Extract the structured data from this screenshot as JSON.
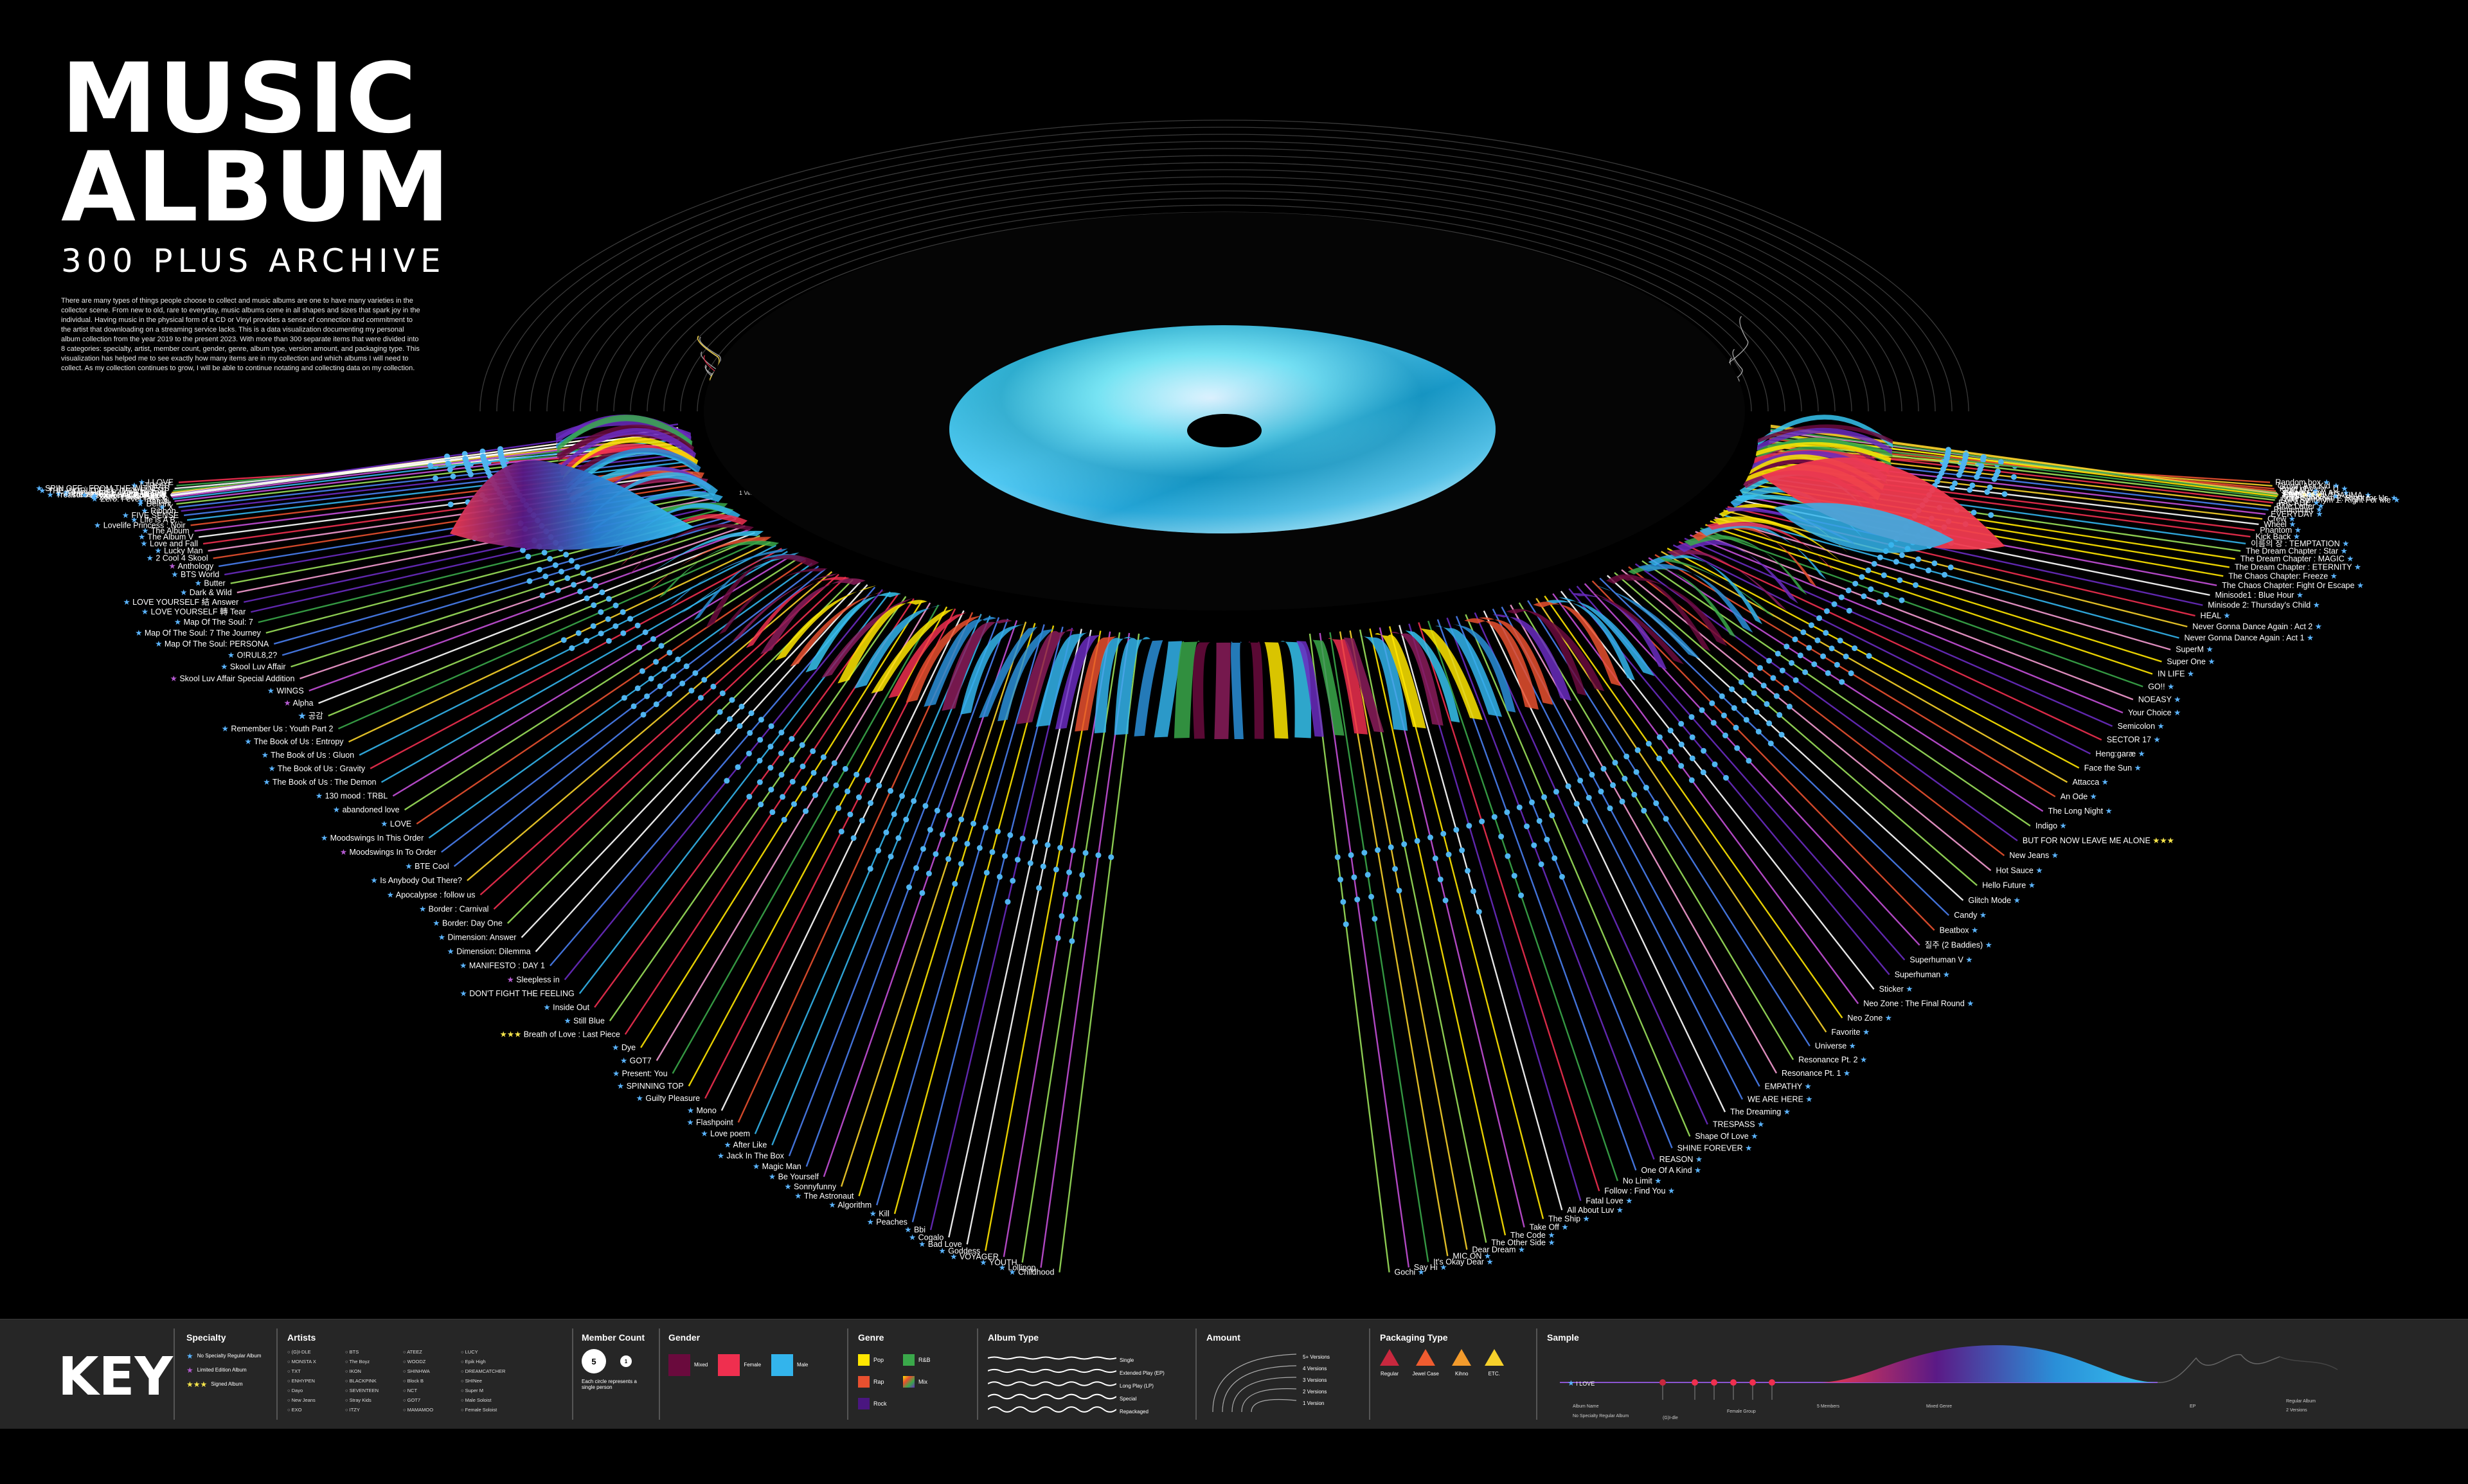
{
  "header": {
    "title_line1": "MUSIC",
    "title_line2": "ALBUM",
    "subtitle": "300 PLUS ARCHIVE",
    "description": "There are many types of things people choose to collect and music albums are one to have many varieties in the collector scene. From new to old, rare to everyday, music albums come in all shapes and sizes that spark joy in the individual. Having music in the physical form of a CD or Vinyl provides a sense of connection and commitment to the artist that downloading on a streaming service lacks. This is a data visualization documenting my personal album collection from the year 2019 to the present 2023. With more than 300 separate items that were divided into 8 categories: specialty, artist, member count, gender, genre, album type, version amount, and packaging type. This visualization has helped me to see exactly how many items are in my collection and which albums I will need to collect. As my collection continues to grow, I will be able to continue notating and collecting data on my collection."
  },
  "rings": {
    "labels": [
      "1 Version",
      "2 Versions",
      "3 Versions",
      "4 Versions",
      "5+ Versions"
    ]
  },
  "colors": {
    "mixed": "#6a0a3d",
    "female": "#ef2f4f",
    "male": "#33b4ec",
    "pop": "#ffe600",
    "rap": "#e8502f",
    "rock": "#4a1680",
    "rnb": "#3aa84a",
    "mix": "#6a2cc0",
    "regular": "#c8283e",
    "jewel": "#ef5c30",
    "kihno": "#f39b2c",
    "etc": "#f7d12b"
  },
  "albums_left": [
    {
      "name": "I LOVE",
      "star": "blue"
    },
    {
      "name": "I TRUST",
      "star": "blue"
    },
    {
      "name": "SPIN OFF : FROM THE WITNESS",
      "star": "blue"
    },
    {
      "name": "THE WORLD EP.1 : MOVEMENT",
      "star": "blue"
    },
    {
      "name": "Treasure EP.1 : All To Zero",
      "star": "blue"
    },
    {
      "name": "Treasure EP.2 : Zero To One",
      "star": "blue"
    },
    {
      "name": "Treasure EP.3 : One To All",
      "star": "blue"
    },
    {
      "name": "Treasure EP. Fin : All To Action",
      "star": "blue"
    },
    {
      "name": "Zero: Fever Epilogue",
      "star": "blue"
    },
    {
      "name": "Zero: Fever Part.1",
      "star": "blue"
    },
    {
      "name": "Zero: Fever Part. 2",
      "star": "blue"
    },
    {
      "name": "Zero: Fever Part. 3",
      "star": "blue"
    },
    {
      "name": "Bambi",
      "star": "blue"
    },
    {
      "name": "Delight",
      "star": "blue"
    },
    {
      "name": "X",
      "star": "blue"
    },
    {
      "name": "Ribbon",
      "star": "blue"
    },
    {
      "name": "FIVE SENSE",
      "star": "blue"
    },
    {
      "name": "Life is A B...",
      "star": "blue"
    },
    {
      "name": "Lovelife Princess : Noir",
      "star": "blue"
    },
    {
      "name": "The Album",
      "star": "blue"
    },
    {
      "name": "The Album V",
      "star": "blue"
    },
    {
      "name": "Love and Fall",
      "star": "blue"
    },
    {
      "name": "Lucky Man",
      "star": "blue"
    },
    {
      "name": "2 Cool 4 Skool",
      "star": "blue"
    },
    {
      "name": "Anthology",
      "star": "purple"
    },
    {
      "name": "BTS World",
      "star": "blue"
    },
    {
      "name": "Butter",
      "star": "blue"
    },
    {
      "name": "Dark & Wild",
      "star": "blue"
    },
    {
      "name": "LOVE YOURSELF 結 Answer",
      "star": "blue"
    },
    {
      "name": "LOVE YOURSELF 轉 Tear",
      "star": "blue"
    },
    {
      "name": "Map Of The Soul: 7",
      "star": "blue"
    },
    {
      "name": "Map Of The Soul: 7 The Journey",
      "star": "blue"
    },
    {
      "name": "Map Of The Soul: PERSONA",
      "star": "blue"
    },
    {
      "name": "O!RUL8,2?",
      "star": "blue"
    },
    {
      "name": "Skool Luv Affair",
      "star": "blue"
    },
    {
      "name": "Skool Luv Affair Special Addition",
      "star": "purple"
    },
    {
      "name": "WINGS",
      "star": "blue"
    },
    {
      "name": "Alpha",
      "star": "purple"
    },
    {
      "name": "공감",
      "star": "blue"
    },
    {
      "name": "Remember Us : Youth Part 2",
      "star": "blue"
    },
    {
      "name": "The Book of Us : Entropy",
      "star": "blue"
    },
    {
      "name": "The Book of Us : Gluon",
      "star": "blue"
    },
    {
      "name": "The Book of Us : Gravity",
      "star": "blue"
    },
    {
      "name": "The Book of Us : The Demon",
      "star": "blue"
    },
    {
      "name": "130 mood : TRBL",
      "star": "blue"
    },
    {
      "name": "abandoned love",
      "star": "blue"
    },
    {
      "name": "LOVE",
      "star": "blue"
    },
    {
      "name": "Moodswings In This Order",
      "star": "blue"
    },
    {
      "name": "Moodswings In To Order",
      "star": "purple"
    },
    {
      "name": "BTE Cool",
      "star": "blue"
    },
    {
      "name": "Is Anybody Out There?",
      "star": "blue"
    },
    {
      "name": "Apocalypse : follow us",
      "star": "blue"
    },
    {
      "name": "Border : Carnival",
      "star": "blue"
    },
    {
      "name": "Border: Day One",
      "star": "blue"
    },
    {
      "name": "Dimension: Answer",
      "star": "blue"
    },
    {
      "name": "Dimension: Dilemma",
      "star": "blue"
    },
    {
      "name": "MANIFESTO : DAY 1",
      "star": "blue"
    },
    {
      "name": "Sleepless in",
      "star": "purple"
    },
    {
      "name": "DON'T FIGHT THE FEELING",
      "star": "blue"
    },
    {
      "name": "Inside Out",
      "star": "blue"
    },
    {
      "name": "Still Blue",
      "star": "blue"
    },
    {
      "name": "Breath of Love : Last Piece",
      "star": "yellow"
    },
    {
      "name": "Dye",
      "star": "blue"
    },
    {
      "name": "GOT7",
      "star": "blue"
    },
    {
      "name": "Present: You",
      "star": "blue"
    },
    {
      "name": "SPINNING TOP",
      "star": "blue"
    },
    {
      "name": "Guilty Pleasure",
      "star": "blue"
    },
    {
      "name": "Mono",
      "star": "blue"
    },
    {
      "name": "Flashpoint",
      "star": "blue"
    },
    {
      "name": "Love poem",
      "star": "blue"
    },
    {
      "name": "After Like",
      "star": "blue"
    },
    {
      "name": "Jack In The Box",
      "star": "blue"
    },
    {
      "name": "Magic Man",
      "star": "blue"
    },
    {
      "name": "Be Yourself",
      "star": "blue"
    },
    {
      "name": "Sonnyfunny",
      "star": "blue"
    },
    {
      "name": "The Astronaut",
      "star": "blue"
    },
    {
      "name": "Algorithm",
      "star": "blue"
    },
    {
      "name": "Kill",
      "star": "blue"
    },
    {
      "name": "Peaches",
      "star": "blue"
    },
    {
      "name": "Bbi",
      "star": "blue"
    },
    {
      "name": "Cogalo",
      "star": "blue"
    },
    {
      "name": "Bad Love",
      "star": "blue"
    },
    {
      "name": "Goddess",
      "star": "blue"
    },
    {
      "name": "VOYAGER",
      "star": "blue"
    },
    {
      "name": "YOUTH",
      "star": "blue"
    },
    {
      "name": "Lollipop",
      "star": "blue"
    },
    {
      "name": "Childhood",
      "star": "blue"
    }
  ],
  "albums_right": [
    {
      "name": "Random box",
      "star": "blue"
    },
    {
      "name": "Grown Ass Kid",
      "star": "blue"
    },
    {
      "name": "Point of View : U",
      "star": "blue"
    },
    {
      "name": "SUGAR",
      "star": "blue"
    },
    {
      "name": "Colors From Ars",
      "star": "blue"
    },
    {
      "name": "Eternal",
      "star": "blue"
    },
    {
      "name": "SET",
      "star": "yellow"
    },
    {
      "name": "Equal",
      "star": "blue"
    },
    {
      "name": "COLORFUL TRAUMA",
      "star": "blue"
    },
    {
      "name": "OBSESSION",
      "star": "blue"
    },
    {
      "name": "Love Synonym 2: Right for Us",
      "star": "blue"
    },
    {
      "name": "Love Synonym 1: Right For Me",
      "star": "blue"
    },
    {
      "name": "FACADE",
      "star": "blue"
    },
    {
      "name": "Blue Letter",
      "star": "blue"
    },
    {
      "name": "Remember",
      "star": "blue"
    },
    {
      "name": "EVERYDAY",
      "star": "blue"
    },
    {
      "name": "Crew",
      "star": "blue"
    },
    {
      "name": "Wheel",
      "star": "blue"
    },
    {
      "name": "Phantom",
      "star": "blue"
    },
    {
      "name": "Kick Back",
      "star": "blue"
    },
    {
      "name": "이름의 장 : TEMPTATION",
      "star": "blue"
    },
    {
      "name": "The Dream Chapter : Star",
      "star": "blue"
    },
    {
      "name": "The Dream Chapter : MAGIC",
      "star": "blue"
    },
    {
      "name": "The Dream Chapter : ETERNITY",
      "star": "blue"
    },
    {
      "name": "The Chaos Chapter: Freeze",
      "star": "blue"
    },
    {
      "name": "The Chaos Chapter: Fight Or Escape",
      "star": "blue"
    },
    {
      "name": "Minisode1 : Blue Hour",
      "star": "blue"
    },
    {
      "name": "Minisode 2: Thursday's Child",
      "star": "blue"
    },
    {
      "name": "HEAL",
      "star": "blue"
    },
    {
      "name": "Never Gonna Dance Again : Act 2",
      "star": "blue"
    },
    {
      "name": "Never Gonna Dance Again : Act 1",
      "star": "blue"
    },
    {
      "name": "SuperM",
      "star": "blue"
    },
    {
      "name": "Super One",
      "star": "blue"
    },
    {
      "name": "IN LIFE",
      "star": "blue"
    },
    {
      "name": "GO!!",
      "star": "blue"
    },
    {
      "name": "NOEASY",
      "star": "blue"
    },
    {
      "name": "Your Choice",
      "star": "blue"
    },
    {
      "name": "Semicolon",
      "star": "blue"
    },
    {
      "name": "SECTOR 17",
      "star": "blue"
    },
    {
      "name": "Heng:garæ",
      "star": "blue"
    },
    {
      "name": "Face the Sun",
      "star": "blue"
    },
    {
      "name": "Attacca",
      "star": "blue"
    },
    {
      "name": "An Ode",
      "star": "blue"
    },
    {
      "name": "The Long Night",
      "star": "blue"
    },
    {
      "name": "Indigo",
      "star": "blue"
    },
    {
      "name": "BUT FOR NOW LEAVE ME ALONE",
      "star": "yellow"
    },
    {
      "name": "New Jeans",
      "star": "blue"
    },
    {
      "name": "Hot Sauce",
      "star": "blue"
    },
    {
      "name": "Hello Future",
      "star": "blue"
    },
    {
      "name": "Glitch Mode",
      "star": "blue"
    },
    {
      "name": "Candy",
      "star": "blue"
    },
    {
      "name": "Beatbox",
      "star": "blue"
    },
    {
      "name": "질주 (2 Baddies)",
      "star": "blue"
    },
    {
      "name": "Superhuman V",
      "star": "blue"
    },
    {
      "name": "Superhuman",
      "star": "blue"
    },
    {
      "name": "Sticker",
      "star": "blue"
    },
    {
      "name": "Neo Zone : The Final Round",
      "star": "blue"
    },
    {
      "name": "Neo Zone",
      "star": "blue"
    },
    {
      "name": "Favorite",
      "star": "blue"
    },
    {
      "name": "Universe",
      "star": "blue"
    },
    {
      "name": "Resonance Pt. 2",
      "star": "blue"
    },
    {
      "name": "Resonance Pt. 1",
      "star": "blue"
    },
    {
      "name": "EMPATHY",
      "star": "blue"
    },
    {
      "name": "WE ARE HERE",
      "star": "blue"
    },
    {
      "name": "The Dreaming",
      "star": "blue"
    },
    {
      "name": "TRESPASS",
      "star": "blue"
    },
    {
      "name": "Shape Of Love",
      "star": "blue"
    },
    {
      "name": "SHINE FOREVER",
      "star": "blue"
    },
    {
      "name": "REASON",
      "star": "blue"
    },
    {
      "name": "One Of A Kind",
      "star": "blue"
    },
    {
      "name": "No Limit",
      "star": "blue"
    },
    {
      "name": "Follow : Find You",
      "star": "blue"
    },
    {
      "name": "Fatal Love",
      "star": "blue"
    },
    {
      "name": "All About Luv",
      "star": "blue"
    },
    {
      "name": "The Ship",
      "star": "blue"
    },
    {
      "name": "Take Off",
      "star": "blue"
    },
    {
      "name": "The Code",
      "star": "blue"
    },
    {
      "name": "The Other Side",
      "star": "blue"
    },
    {
      "name": "Dear Dream",
      "star": "blue"
    },
    {
      "name": "MIC ON",
      "star": "blue"
    },
    {
      "name": "It's Okay Dear",
      "star": "blue"
    },
    {
      "name": "Say Hi",
      "star": "blue"
    },
    {
      "name": "Gochi",
      "star": "blue"
    }
  ],
  "key": {
    "title": "KEY",
    "specialty": {
      "heading": "Specialty",
      "items": [
        "No Specialty Regular Album",
        "Limited Edition Album",
        "Signed Album"
      ]
    },
    "artists": {
      "heading": "Artists",
      "items": [
        "(G)I-DLE",
        "MONSTA X",
        "TXT",
        "ENHYPEN",
        "Dayo",
        "New Jeans",
        "EXO",
        "BTS",
        "The Boyz",
        "IKON",
        "BLACKPINK",
        "SEVENTEEN",
        "Stray Kids",
        "ITZY",
        "ATEEZ",
        "WOODZ",
        "SHINHWA",
        "Block B",
        "NCT",
        "GOT7",
        "MAMAMOO",
        "LUCY",
        "Epik High",
        "DREAMCATCHER",
        "SHINee",
        "Super M",
        "Male Soloist",
        "Female Soloist",
        "IVE",
        "ENHYPEN"
      ]
    },
    "member": {
      "heading": "Member Count",
      "big": "5",
      "small": "1",
      "note": "Each circle represents a single person"
    },
    "gender": {
      "heading": "Gender",
      "items": [
        "Mixed",
        "Female",
        "Male"
      ]
    },
    "genre": {
      "heading": "Genre",
      "items": [
        "Pop",
        "R&B",
        "Rap",
        "Mix",
        "Rock"
      ]
    },
    "album_type": {
      "heading": "Album Type",
      "items": [
        "Single",
        "Extended Play (EP)",
        "Long Play (LP)",
        "Special",
        "Repackaged"
      ]
    },
    "amount": {
      "heading": "Amount",
      "items": [
        "5+ Versions",
        "4 Versions",
        "3 Versions",
        "2 Versions",
        "1 Version"
      ]
    },
    "packaging": {
      "heading": "Packaging Type",
      "items": [
        "Regular",
        "Jewel Case",
        "Kihno",
        "ETC."
      ]
    },
    "sample": {
      "heading": "Sample",
      "album": "I LOVE",
      "labels": [
        "Album Name",
        "No Specialty Regular Album",
        "(G)I-dle",
        "Female Group",
        "5 Members",
        "Mixed Genre",
        "EP",
        "Regular Album",
        "2 Versions"
      ]
    }
  }
}
